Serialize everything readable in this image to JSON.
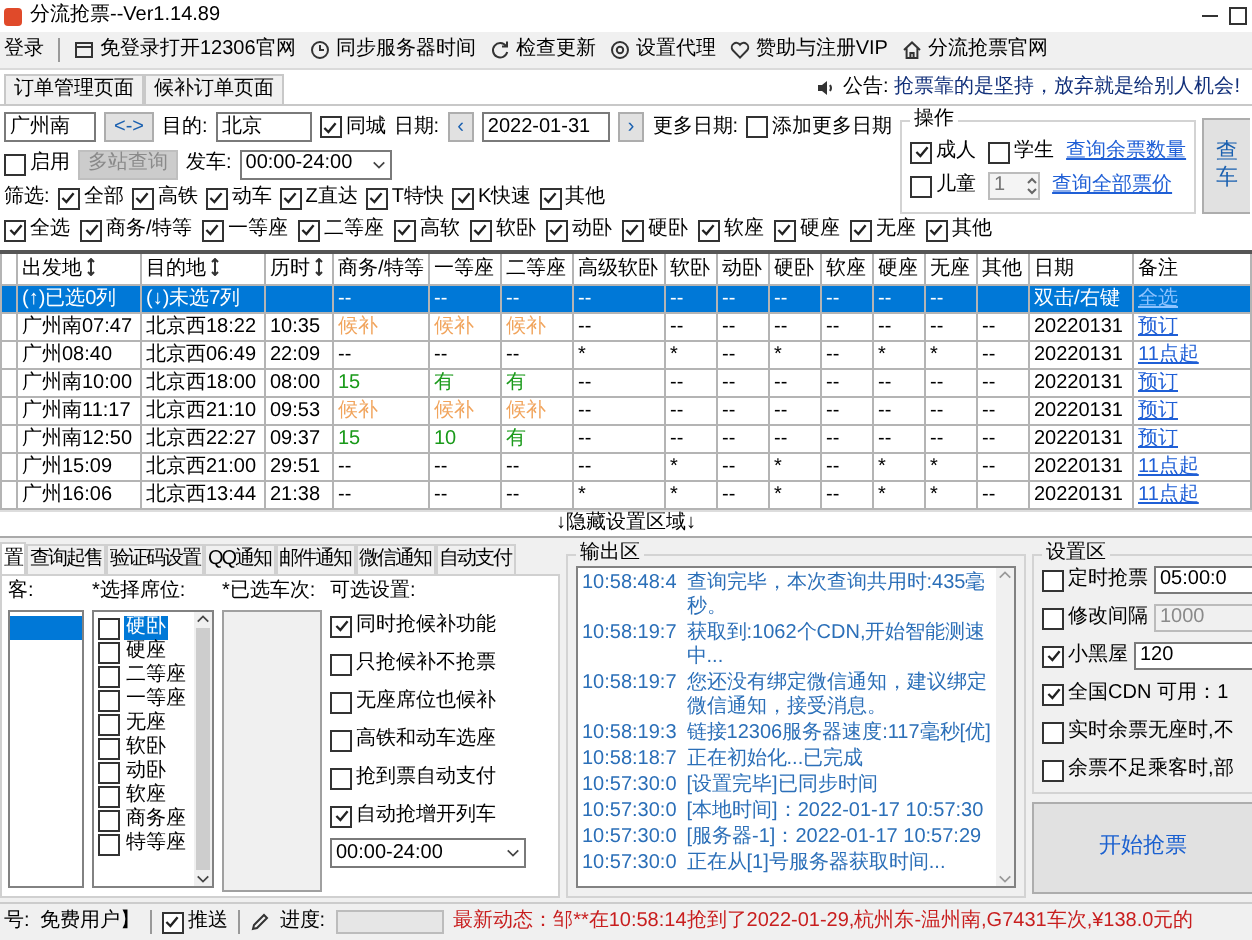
{
  "window": {
    "title": "分流抢票--Ver1.14.89"
  },
  "toolbar": [
    {
      "label": "登录"
    },
    {
      "label": "免登录打开12306官网"
    },
    {
      "label": "同步服务器时间"
    },
    {
      "label": "检查更新"
    },
    {
      "label": "设置代理"
    },
    {
      "label": "赞助与注册VIP"
    },
    {
      "label": "分流抢票官网"
    }
  ],
  "page_tabs": [
    {
      "label": "订单管理页面",
      "selected": false
    },
    {
      "label": "候补订单页面",
      "selected": false
    }
  ],
  "notice": {
    "label": "公告:",
    "text": "抢票靠的是坚持，放弃就是给别人机会!"
  },
  "query": {
    "from": "广州南",
    "swap": "<->",
    "to_label": "目的:",
    "to": "北京",
    "same_city": {
      "label": "同城",
      "checked": true
    },
    "date_label": "日期:",
    "prev": "‹",
    "date": "2022-01-31",
    "next": "›",
    "more_dates_label": "更多日期:",
    "add_more": {
      "label": "添加更多日期",
      "checked": false
    },
    "enable": {
      "label": "启用",
      "checked": false
    },
    "multi_station": {
      "label": "多站查询",
      "disabled": true
    },
    "depart_label": "发车:",
    "depart": "00:00-24:00",
    "filter_label": "筛选:",
    "train_filters": [
      {
        "label": "全部",
        "checked": true
      },
      {
        "label": "高铁",
        "checked": true
      },
      {
        "label": "动车",
        "checked": true
      },
      {
        "label": "Z直达",
        "checked": true
      },
      {
        "label": "T特快",
        "checked": true
      },
      {
        "label": "K快速",
        "checked": true
      },
      {
        "label": "其他",
        "checked": true
      }
    ],
    "seat_filters": [
      {
        "label": "全选",
        "checked": true
      },
      {
        "label": "商务/特等",
        "checked": true
      },
      {
        "label": "一等座",
        "checked": true
      },
      {
        "label": "二等座",
        "checked": true
      },
      {
        "label": "高软",
        "checked": true
      },
      {
        "label": "软卧",
        "checked": true
      },
      {
        "label": "动卧",
        "checked": true
      },
      {
        "label": "硬卧",
        "checked": true
      },
      {
        "label": "软座",
        "checked": true
      },
      {
        "label": "硬座",
        "checked": true
      },
      {
        "label": "无座",
        "checked": true
      },
      {
        "label": "其他",
        "checked": true
      }
    ]
  },
  "operation": {
    "title": "操作",
    "adult": {
      "label": "成人",
      "checked": true
    },
    "student": {
      "label": "学生",
      "checked": false
    },
    "child": {
      "label": "儿童",
      "checked": false
    },
    "child_count": "1",
    "links": [
      "查询余票数量",
      "查询全部票价"
    ],
    "query_button": [
      "查",
      "车"
    ]
  },
  "table": {
    "columns": [
      {
        "label": "出发地",
        "sortable": true
      },
      {
        "label": "目的地",
        "sortable": true
      },
      {
        "label": "历时",
        "sortable": true
      },
      {
        "label": "商务/特等",
        "sortable": false
      },
      {
        "label": "一等座",
        "sortable": false
      },
      {
        "label": "二等座",
        "sortable": false
      },
      {
        "label": "高级软卧",
        "sortable": false
      },
      {
        "label": "软卧",
        "sortable": false
      },
      {
        "label": "动卧",
        "sortable": false
      },
      {
        "label": "硬卧",
        "sortable": false
      },
      {
        "label": "软座",
        "sortable": false
      },
      {
        "label": "硬座",
        "sortable": false
      },
      {
        "label": "无座",
        "sortable": false
      },
      {
        "label": "其他",
        "sortable": false
      },
      {
        "label": "日期",
        "sortable": false
      },
      {
        "label": "备注",
        "sortable": false
      }
    ],
    "rows": [
      {
        "selected": true,
        "cells": [
          "(↑)已选0列",
          "(↓)未选7列",
          null,
          "--",
          "--",
          "--",
          "--",
          "--",
          "--",
          "--",
          "--",
          "--",
          "--",
          null,
          "双击/右键",
          {
            "text": "全选",
            "kind": "link"
          }
        ]
      },
      {
        "selected": false,
        "cells": [
          "广州南07:47",
          "北京西18:22",
          "10:35",
          {
            "text": "候补",
            "kind": "waitlist"
          },
          {
            "text": "候补",
            "kind": "waitlist"
          },
          {
            "text": "候补",
            "kind": "waitlist"
          },
          "--",
          "--",
          "--",
          "--",
          "--",
          "--",
          "--",
          "--",
          "20220131",
          {
            "text": "预订",
            "kind": "link"
          }
        ]
      },
      {
        "selected": false,
        "cells": [
          "广州08:40",
          "北京西06:49",
          "22:09",
          "--",
          "--",
          "--",
          "*",
          "*",
          "--",
          "*",
          "--",
          "*",
          "*",
          "--",
          "20220131",
          {
            "text": "11点起",
            "kind": "link"
          }
        ]
      },
      {
        "selected": false,
        "cells": [
          "广州南10:00",
          "北京西18:00",
          "08:00",
          {
            "text": "15",
            "kind": "available"
          },
          {
            "text": "有",
            "kind": "available"
          },
          {
            "text": "有",
            "kind": "available"
          },
          "--",
          "--",
          "--",
          "--",
          "--",
          "--",
          "--",
          "--",
          "20220131",
          {
            "text": "预订",
            "kind": "link"
          }
        ]
      },
      {
        "selected": false,
        "cells": [
          "广州南11:17",
          "北京西21:10",
          "09:53",
          {
            "text": "候补",
            "kind": "waitlist"
          },
          {
            "text": "候补",
            "kind": "waitlist"
          },
          {
            "text": "候补",
            "kind": "waitlist"
          },
          "--",
          "--",
          "--",
          "--",
          "--",
          "--",
          "--",
          "--",
          "20220131",
          {
            "text": "预订",
            "kind": "link"
          }
        ]
      },
      {
        "selected": false,
        "cells": [
          "广州南12:50",
          "北京西22:27",
          "09:37",
          {
            "text": "15",
            "kind": "available"
          },
          {
            "text": "10",
            "kind": "available"
          },
          {
            "text": "有",
            "kind": "available"
          },
          "--",
          "--",
          "--",
          "--",
          "--",
          "--",
          "--",
          "--",
          "20220131",
          {
            "text": "预订",
            "kind": "link"
          }
        ]
      },
      {
        "selected": false,
        "cells": [
          "广州15:09",
          "北京西21:00",
          "29:51",
          "--",
          "--",
          "--",
          "--",
          "*",
          "--",
          "*",
          "--",
          "*",
          "*",
          "--",
          "20220131",
          {
            "text": "11点起",
            "kind": "link"
          }
        ]
      },
      {
        "selected": false,
        "cells": [
          "广州16:06",
          "北京西13:44",
          "21:38",
          "--",
          "--",
          "--",
          "*",
          "*",
          "--",
          "*",
          "--",
          "*",
          "*",
          "--",
          "20220131",
          {
            "text": "11点起",
            "kind": "link"
          }
        ]
      }
    ]
  },
  "toggle": "↓隐藏设置区域↓",
  "settings_tabs": [
    {
      "label": "置",
      "selected": true
    },
    {
      "label": "查询起售",
      "selected": false
    },
    {
      "label": "验证码设置",
      "selected": false
    },
    {
      "label": "QQ通知",
      "selected": false
    },
    {
      "label": "邮件通知",
      "selected": false
    },
    {
      "label": "微信通知",
      "selected": false
    },
    {
      "label": "自动支付",
      "selected": false
    }
  ],
  "passenger_panel": {
    "label": "客:",
    "items": [
      {
        "selected": true
      }
    ]
  },
  "seat_panel": {
    "label": "*选择席位:",
    "items": [
      {
        "label": "硬卧",
        "checked": false,
        "selected": true
      },
      {
        "label": "硬座",
        "checked": false,
        "selected": false
      },
      {
        "label": "二等座",
        "checked": false,
        "selected": false
      },
      {
        "label": "一等座",
        "checked": false,
        "selected": false
      },
      {
        "label": "无座",
        "checked": false,
        "selected": false
      },
      {
        "label": "软卧",
        "checked": false,
        "selected": false
      },
      {
        "label": "动卧",
        "checked": false,
        "selected": false
      },
      {
        "label": "软座",
        "checked": false,
        "selected": false
      },
      {
        "label": "商务座",
        "checked": false,
        "selected": false
      },
      {
        "label": "特等座",
        "checked": false,
        "selected": false
      }
    ]
  },
  "train_panel": {
    "label": "*已选车次:"
  },
  "options": {
    "label": "可选设置:",
    "items": [
      {
        "label": "同时抢候补功能",
        "checked": true
      },
      {
        "label": "只抢候补不抢票",
        "checked": false
      },
      {
        "label": "无座席位也候补",
        "checked": false
      },
      {
        "label": "高铁和动车选座",
        "checked": false
      },
      {
        "label": "抢到票自动支付",
        "checked": false
      },
      {
        "label": "自动抢增开列车",
        "checked": true
      }
    ],
    "time": "00:00-24:00"
  },
  "output": {
    "title": "输出区",
    "lines": [
      {
        "time": "10:58:48:4",
        "text": "查询完毕，本次查询共用时:435毫秒。"
      },
      {
        "time": "10:58:19:7",
        "text": "获取到:1062个CDN,开始智能测速中..."
      },
      {
        "time": "10:58:19:7",
        "text": "您还没有绑定微信通知，建议绑定微信通知，接受消息。"
      },
      {
        "time": "10:58:19:3",
        "text": "链接12306服务器速度:117毫秒[优]"
      },
      {
        "time": "10:58:18:7",
        "text": "正在初始化...已完成"
      },
      {
        "time": "10:57:30:0",
        "text": "[设置完毕]已同步时间"
      },
      {
        "time": "10:57:30:0",
        "text": "[本地时间]：2022-01-17 10:57:30"
      },
      {
        "time": "10:57:30:0",
        "text": "[服务器-1]：2022-01-17 10:57:29"
      },
      {
        "time": "10:57:30:0",
        "text": "正在从[1]号服务器获取时间..."
      }
    ]
  },
  "settings": {
    "title": "设置区",
    "items": [
      {
        "kind": "input",
        "label": "定时抢票",
        "checked": false,
        "value": "05:00:0",
        "disabled": false
      },
      {
        "kind": "input",
        "label": "修改间隔",
        "checked": false,
        "value": "1000",
        "disabled": true
      },
      {
        "kind": "input",
        "label": "小黑屋",
        "checked": true,
        "value": "120",
        "disabled": false
      },
      {
        "kind": "note",
        "label": "全国CDN",
        "checked": true,
        "note": "可用：1"
      },
      {
        "kind": "plain",
        "label": "实时余票无座时,不",
        "checked": false
      },
      {
        "kind": "plain",
        "label": "余票不足乘客时,部",
        "checked": false
      }
    ],
    "start_button": "开始抢票"
  },
  "status": {
    "account_label": "号:",
    "account": "免费用户】",
    "push": {
      "label": "推送",
      "checked": true
    },
    "progress_label": "进度:",
    "progress": {
      "level": 0
    },
    "news": "最新动态：邹**在10:58:14抢到了2022-01-29,杭州东-温州南,G7431车次,¥138.0元的"
  }
}
